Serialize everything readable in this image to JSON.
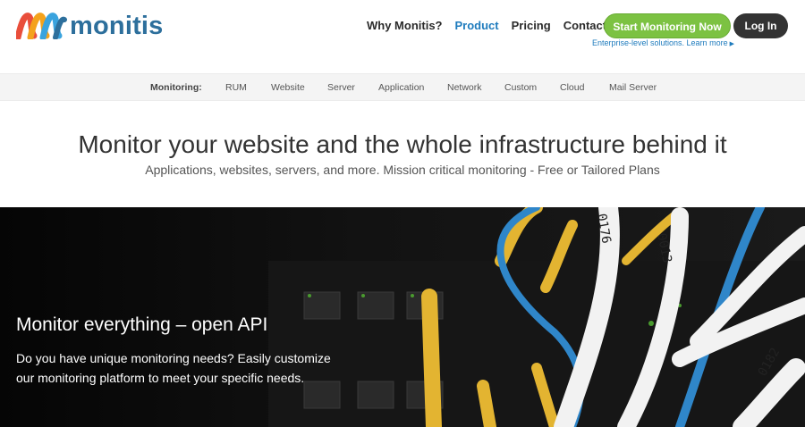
{
  "brand": {
    "name": "monitis",
    "primary_color": "#2d6f9c",
    "accent_green": "#7cc242"
  },
  "nav": {
    "items": [
      {
        "label": "Why Monitis?"
      },
      {
        "label": "Product",
        "active": true
      },
      {
        "label": "Pricing"
      },
      {
        "label": "Contact Us"
      }
    ],
    "start_button": "Start Monitoring Now",
    "login_button": "Log In",
    "tagline": "Enterprise-level solutions. Learn more"
  },
  "subnav": {
    "label": "Monitoring:",
    "items": [
      "RUM",
      "Website",
      "Server",
      "Application",
      "Network",
      "Custom",
      "Cloud",
      "Mail Server"
    ]
  },
  "headline": "Monitor your website and the whole infrastructure behind it",
  "subheadline": "Applications, websites, servers, and more. Mission critical monitoring - Free or Tailored Plans",
  "hero": {
    "title": "Monitor everything – open API",
    "text": "Do you have unique monitoring needs? Easily customize our monitoring platform to meet your specific needs.",
    "cable_labels": [
      "0176",
      "0013",
      "0182"
    ]
  }
}
